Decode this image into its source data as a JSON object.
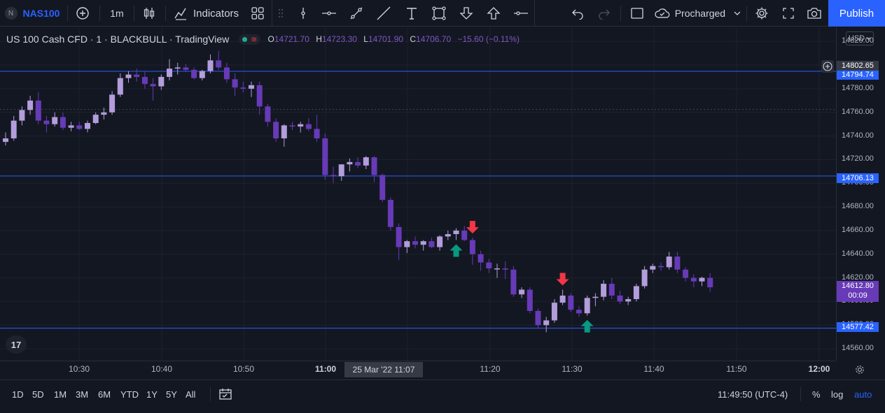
{
  "toolbar": {
    "symbol_badge": "N",
    "symbol": "NAS100",
    "interval": "1m",
    "indicators_label": "Indicators",
    "layout_name": "Procharged",
    "publish_label": "Publish"
  },
  "legend": {
    "title": "US 100 Cash CFD · 1 · BLACKBULL · TradingView",
    "o_label": "O",
    "o_val": "14721.70",
    "h_label": "H",
    "h_val": "14723.30",
    "l_label": "L",
    "l_val": "14701.90",
    "c_label": "C",
    "c_val": "14706.70",
    "change": "−15.60 (−0.11%)"
  },
  "price_axis": {
    "currency": "USD",
    "labels": [
      "14820.00",
      "14800.00",
      "14780.00",
      "14760.00",
      "14740.00",
      "14720.00",
      "14700.00",
      "14680.00",
      "14660.00",
      "14640.00",
      "14620.00",
      "14600.00",
      "14580.00",
      "14560.00"
    ],
    "hline_top": "14794.74",
    "crosshair_price": "14802.65",
    "hline_mid": "14706.13",
    "last_price": "14612.80",
    "countdown": "00:09",
    "hline_bottom": "14577.42"
  },
  "time_axis": {
    "labels": [
      "10:30",
      "10:40",
      "10:50",
      "11:00",
      "11:20",
      "11:30",
      "11:40",
      "11:50",
      "12:00"
    ],
    "crosshair_label": "25 Mar '22   11:07"
  },
  "bottom_bar": {
    "ranges": [
      "1D",
      "5D",
      "1M",
      "3M",
      "6M",
      "YTD",
      "1Y",
      "5Y",
      "All"
    ],
    "clock": "11:49:50 (UTC-4)",
    "percent": "%",
    "log": "log",
    "auto": "auto"
  },
  "logo_text": "17",
  "colors": {
    "background": "#131722",
    "candle_up": "#b39ddb",
    "candle_down": "#673ab7",
    "hline": "#2962ff",
    "arrow_up": "#089981",
    "arrow_down": "#f23645"
  },
  "chart_data": {
    "type": "candlestick",
    "symbol": "NAS100",
    "interval": "1m",
    "ylim": [
      14550,
      14832
    ],
    "horizontal_lines": [
      14794.74,
      14706.13,
      14577.42
    ],
    "candles": [
      [
        14735,
        14743,
        14732,
        14738
      ],
      [
        14738,
        14757,
        14736,
        14753
      ],
      [
        14753,
        14765,
        14749,
        14762
      ],
      [
        14762,
        14774,
        14758,
        14770
      ],
      [
        14770,
        14777,
        14750,
        14753
      ],
      [
        14753,
        14757,
        14743,
        14750
      ],
      [
        14750,
        14760,
        14748,
        14756
      ],
      [
        14756,
        14760,
        14745,
        14747
      ],
      [
        14747,
        14752,
        14744,
        14749
      ],
      [
        14749,
        14752,
        14745,
        14746
      ],
      [
        14746,
        14753,
        14743,
        14751
      ],
      [
        14751,
        14760,
        14750,
        14758
      ],
      [
        14758,
        14764,
        14754,
        14760
      ],
      [
        14760,
        14778,
        14758,
        14775
      ],
      [
        14775,
        14793,
        14773,
        14789
      ],
      [
        14789,
        14795,
        14785,
        14792
      ],
      [
        14792,
        14797,
        14786,
        14790
      ],
      [
        14790,
        14795,
        14780,
        14784
      ],
      [
        14784,
        14789,
        14770,
        14782
      ],
      [
        14782,
        14792,
        14779,
        14790
      ],
      [
        14790,
        14805,
        14787,
        14797
      ],
      [
        14797,
        14802,
        14792,
        14798
      ],
      [
        14798,
        14801,
        14794,
        14796
      ],
      [
        14796,
        14798,
        14788,
        14789
      ],
      [
        14789,
        14796,
        14787,
        14795
      ],
      [
        14795,
        14809,
        14793,
        14804
      ],
      [
        14804,
        14812,
        14796,
        14798
      ],
      [
        14798,
        14802,
        14785,
        14788
      ],
      [
        14788,
        14793,
        14774,
        14781
      ],
      [
        14781,
        14786,
        14777,
        14780
      ],
      [
        14780,
        14786,
        14773,
        14783
      ],
      [
        14783,
        14786,
        14758,
        14765
      ],
      [
        14765,
        14767,
        14748,
        14752
      ],
      [
        14752,
        14755,
        14735,
        14738
      ],
      [
        14738,
        14750,
        14731,
        14749
      ],
      [
        14749,
        14752,
        14745,
        14748
      ],
      [
        14748,
        14752,
        14743,
        14750
      ],
      [
        14750,
        14755,
        14744,
        14746
      ],
      [
        14746,
        14758,
        14735,
        14738
      ],
      [
        14738,
        14742,
        14703,
        14707
      ],
      [
        14707,
        14714,
        14700,
        14706
      ],
      [
        14706,
        14716,
        14702,
        14716
      ],
      [
        14716,
        14721,
        14710,
        14718
      ],
      [
        14718,
        14722,
        14713,
        14715
      ],
      [
        14715,
        14723,
        14712,
        14722
      ],
      [
        14722,
        14723,
        14701,
        14707
      ],
      [
        14707,
        14708,
        14684,
        14686
      ],
      [
        14686,
        14688,
        14660,
        14663
      ],
      [
        14663,
        14666,
        14635,
        14646
      ],
      [
        14646,
        14652,
        14641,
        14651
      ],
      [
        14651,
        14655,
        14645,
        14648
      ],
      [
        14648,
        14652,
        14643,
        14651
      ],
      [
        14651,
        14654,
        14645,
        14646
      ],
      [
        14646,
        14656,
        14643,
        14655
      ],
      [
        14655,
        14660,
        14652,
        14657
      ],
      [
        14657,
        14662,
        14652,
        14660
      ],
      [
        14660,
        14664,
        14651,
        14652
      ],
      [
        14652,
        14654,
        14631,
        14640
      ],
      [
        14640,
        14643,
        14626,
        14633
      ],
      [
        14633,
        14636,
        14624,
        14628
      ],
      [
        14628,
        14632,
        14620,
        14628
      ],
      [
        14628,
        14634,
        14619,
        14627
      ],
      [
        14627,
        14630,
        14604,
        14606
      ],
      [
        14606,
        14612,
        14603,
        14610
      ],
      [
        14610,
        14612,
        14590,
        14592
      ],
      [
        14592,
        14594,
        14577,
        14580
      ],
      [
        14580,
        14587,
        14574,
        14584
      ],
      [
        14584,
        14602,
        14582,
        14599
      ],
      [
        14599,
        14610,
        14597,
        14605
      ],
      [
        14605,
        14607,
        14591,
        14593
      ],
      [
        14593,
        14596,
        14587,
        14590
      ],
      [
        14590,
        14605,
        14588,
        14603
      ],
      [
        14603,
        14607,
        14596,
        14604
      ],
      [
        14604,
        14618,
        14601,
        14615
      ],
      [
        14615,
        14620,
        14602,
        14605
      ],
      [
        14605,
        14609,
        14598,
        14600
      ],
      [
        14600,
        14604,
        14597,
        14602
      ],
      [
        14602,
        14615,
        14600,
        14613
      ],
      [
        14613,
        14630,
        14611,
        14627
      ],
      [
        14627,
        14632,
        14624,
        14630
      ],
      [
        14630,
        14633,
        14626,
        14629
      ],
      [
        14629,
        14642,
        14627,
        14638
      ],
      [
        14638,
        14642,
        14624,
        14627
      ],
      [
        14627,
        14629,
        14617,
        14620
      ],
      [
        14620,
        14623,
        14612,
        14617
      ],
      [
        14617,
        14621,
        14613,
        14620
      ],
      [
        14620,
        14624,
        14608,
        14612
      ]
    ],
    "signals": [
      {
        "type": "buy",
        "bar": 55
      },
      {
        "type": "sell",
        "bar": 57
      },
      {
        "type": "sell",
        "bar": 68
      },
      {
        "type": "buy",
        "bar": 71
      }
    ]
  }
}
